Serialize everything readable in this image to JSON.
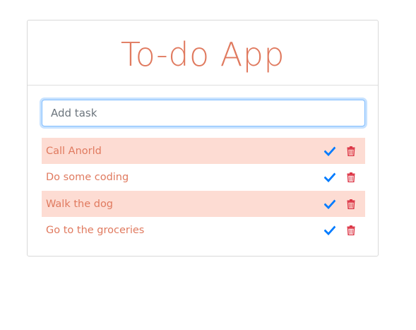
{
  "app": {
    "title": "To-do App"
  },
  "input": {
    "placeholder": "Add task",
    "value": ""
  },
  "tasks": [
    {
      "label": "Call Anorld",
      "highlighted": true
    },
    {
      "label": "Do some coding",
      "highlighted": false
    },
    {
      "label": "Walk the dog",
      "highlighted": true
    },
    {
      "label": "Go to the groceries",
      "highlighted": false
    }
  ],
  "icons": {
    "complete": "check-icon",
    "delete": "trash-icon"
  },
  "colors": {
    "accent": "#e07a5f",
    "row_highlight": "#fddcd3",
    "check": "#007bff",
    "trash": "#dc3545",
    "input_focus": "#80bdff"
  }
}
